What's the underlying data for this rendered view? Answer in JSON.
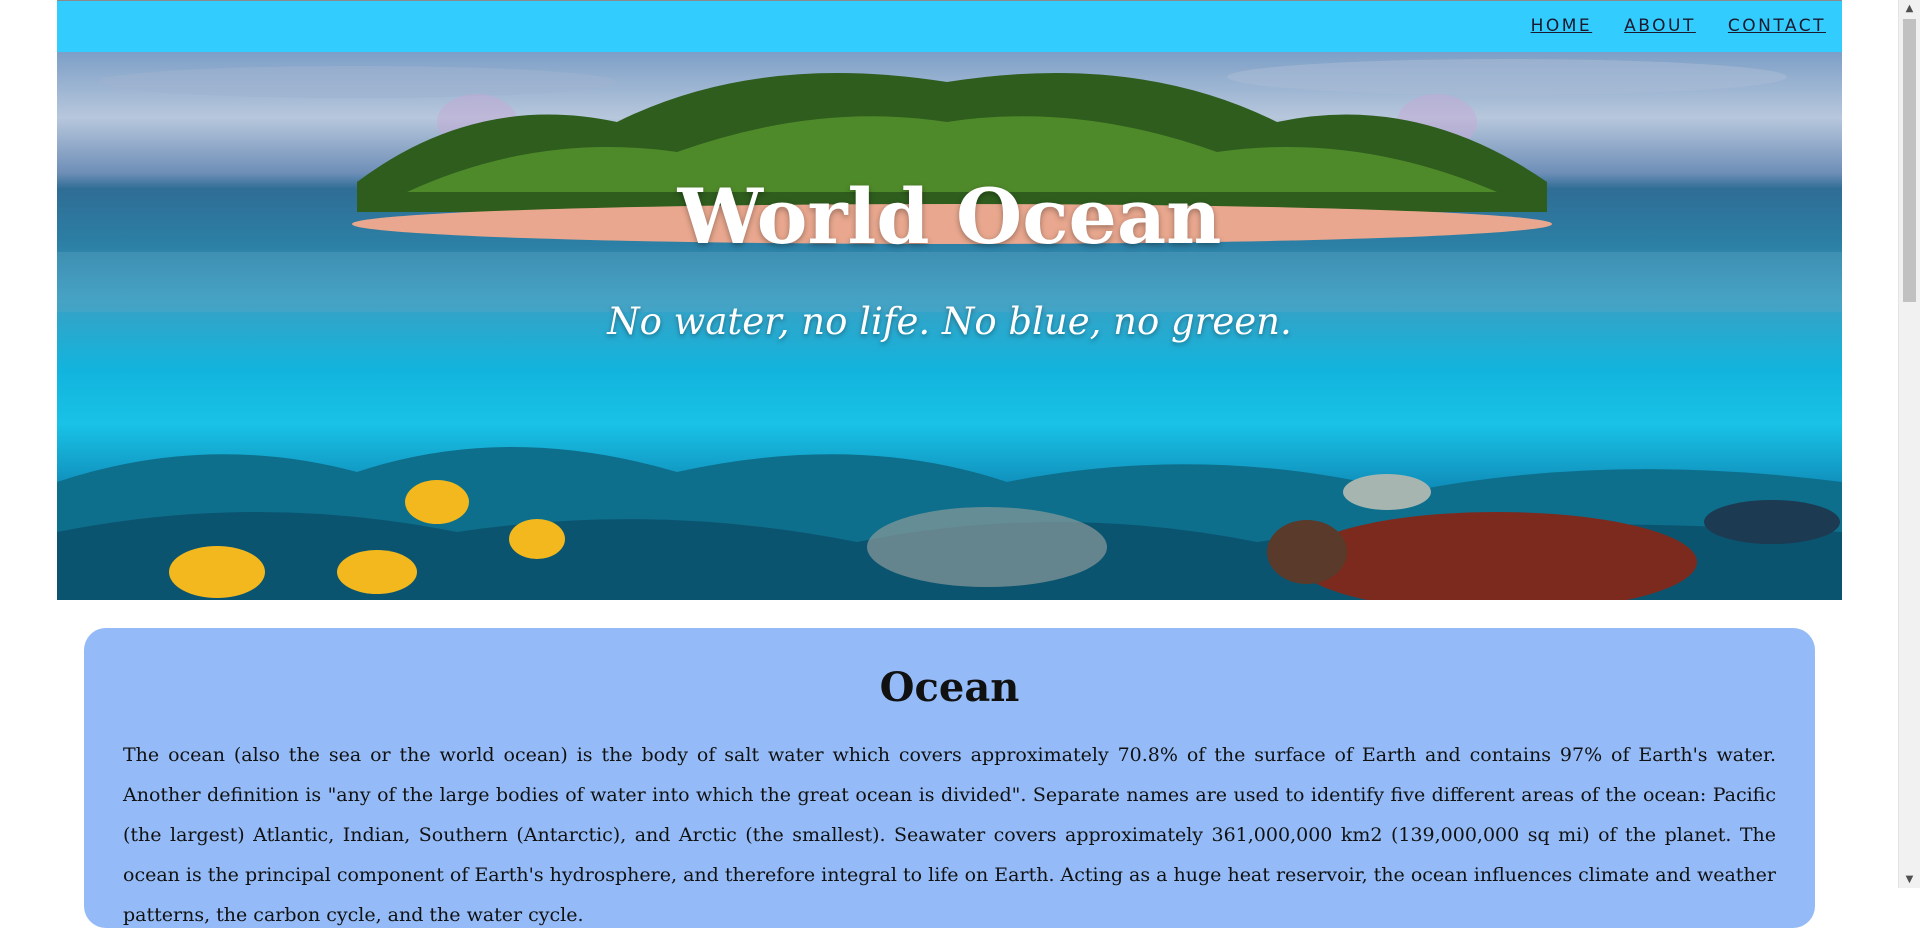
{
  "nav": {
    "items": [
      {
        "label": "HOME"
      },
      {
        "label": "ABOUT"
      },
      {
        "label": "CONTACT"
      }
    ]
  },
  "hero": {
    "title": "World Ocean",
    "subtitle": "No water, no life. No blue, no green."
  },
  "article": {
    "heading": "Ocean",
    "body": "The ocean (also the sea or the world ocean) is the body of salt water which covers approximately 70.8% of the surface of Earth and contains 97% of Earth's water. Another definition is \"any of the large bodies of water into which the great ocean is divided\". Separate names are used to identify five different areas of the ocean: Pacific (the largest) Atlantic, Indian, Southern (Antarctic), and Arctic (the smallest). Seawater covers approximately 361,000,000 km2 (139,000,000 sq mi) of the planet. The ocean is the principal component of Earth's hydrosphere, and therefore integral to life on Earth. Acting as a huge heat reservoir, the ocean influences climate and weather patterns, the carbon cycle, and the water cycle."
  },
  "colors": {
    "topbar": "#33ccff",
    "card": "#94bbf7"
  }
}
